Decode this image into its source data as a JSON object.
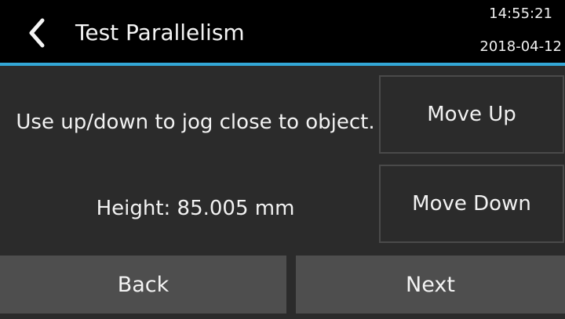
{
  "header": {
    "title": "Test Parallelism",
    "time": "14:55:21",
    "date": "2018-04-12",
    "back_icon": "chevron-left",
    "accent_color": "#33a7d6"
  },
  "main": {
    "instruction": "Use up/down to jog close to object.",
    "height_readout": "Height: 85.005 mm"
  },
  "controls": {
    "move_up_label": "Move Up",
    "move_down_label": "Move Down"
  },
  "footer": {
    "back_label": "Back",
    "next_label": "Next"
  }
}
